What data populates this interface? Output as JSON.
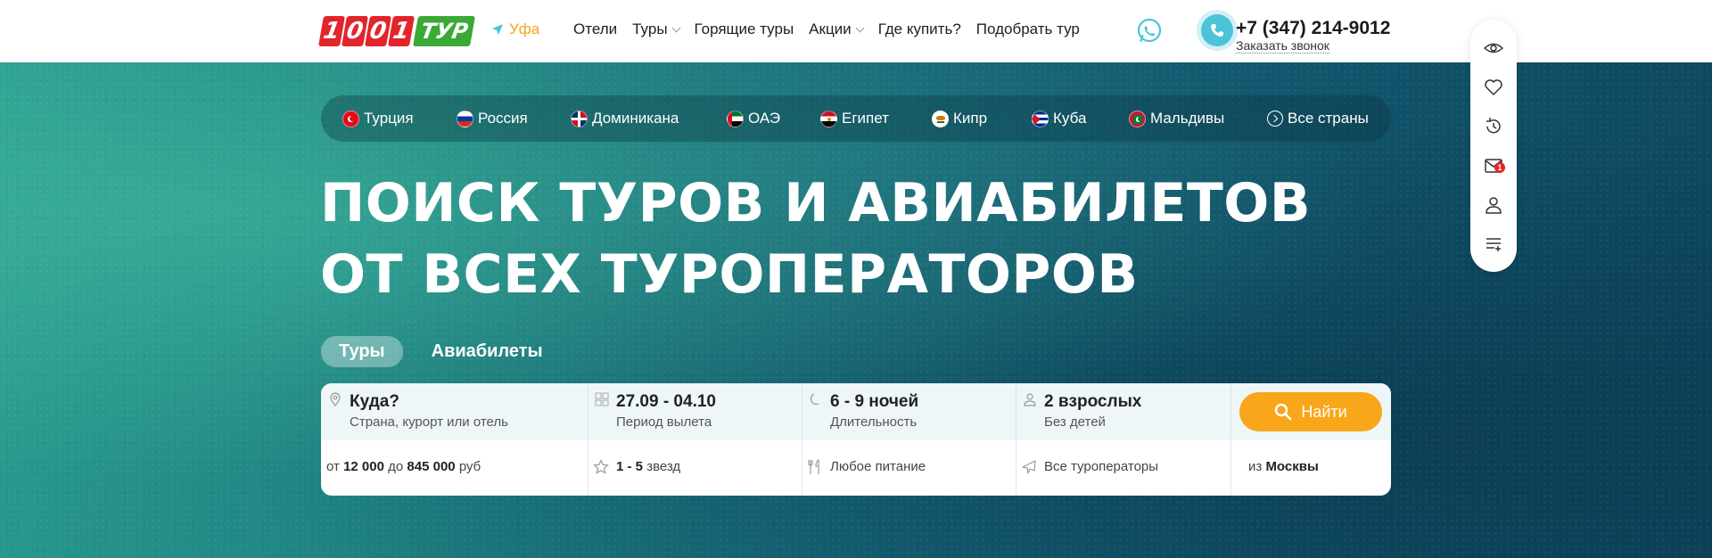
{
  "header": {
    "logo": {
      "digits": [
        "1",
        "0",
        "0",
        "1"
      ],
      "word": "ТУР",
      "colors": {
        "digits": "#e3242b",
        "word": "#3aa935"
      }
    },
    "city": "Уфа",
    "nav": [
      {
        "label": "Отели",
        "has_dropdown": false
      },
      {
        "label": "Туры",
        "has_dropdown": true
      },
      {
        "label": "Горящие туры",
        "has_dropdown": false
      },
      {
        "label": "Акции",
        "has_dropdown": true
      },
      {
        "label": "Где купить?",
        "has_dropdown": false
      },
      {
        "label": "Подобрать тур",
        "has_dropdown": false
      }
    ],
    "phone": "+7 (347) 214-9012",
    "callback": "Заказать звонок"
  },
  "countries": [
    {
      "label": "Турция",
      "flag": "turkey"
    },
    {
      "label": "Россия",
      "flag": "russia"
    },
    {
      "label": "Доминикана",
      "flag": "dominican-republic"
    },
    {
      "label": "ОАЭ",
      "flag": "uae"
    },
    {
      "label": "Египет",
      "flag": "egypt"
    },
    {
      "label": "Кипр",
      "flag": "cyprus"
    },
    {
      "label": "Куба",
      "flag": "cuba"
    },
    {
      "label": "Мальдивы",
      "flag": "maldives"
    },
    {
      "label": "Все страны",
      "icon": "circle-arrow-right-icon"
    }
  ],
  "hero": {
    "title_line1": "ПОИСК ТУРОВ И АВИАБИЛЕТОВ",
    "title_line2": "ОТ ВСЕХ ТУРОПЕРАТОРОВ"
  },
  "tabs": [
    {
      "label": "Туры",
      "active": true
    },
    {
      "label": "Авиабилеты",
      "active": false
    }
  ],
  "search": {
    "destination": {
      "title": "Куда?",
      "hint": "Страна, курорт или отель"
    },
    "dates": {
      "value": "27.09 - 04.10",
      "hint": "Период вылета"
    },
    "nights": {
      "value": "6 - 9 ночей",
      "hint": "Длительность"
    },
    "tourists": {
      "value": "2 взрослых",
      "hint": "Без детей"
    },
    "find_button": "Найти",
    "price": {
      "from_label": "от",
      "from_value": "12 000",
      "to_label": "до",
      "to_value": "845 000",
      "currency": "руб"
    },
    "stars": {
      "value": "1 - 5",
      "label": "звезд"
    },
    "meal": "Любое питание",
    "operators": "Все туроператоры",
    "departure": {
      "prefix": "из",
      "city": "Москвы"
    }
  },
  "side_panel": {
    "icons": [
      "eye-icon",
      "heart-icon",
      "history-icon",
      "mail-icon",
      "user-icon",
      "compare-list-icon"
    ],
    "mail_badge": "1"
  },
  "colors": {
    "accent": "#f9a61a",
    "city": "#f5a516",
    "phone_bubble": "#4cc3d6",
    "badge": "#e3242b"
  }
}
